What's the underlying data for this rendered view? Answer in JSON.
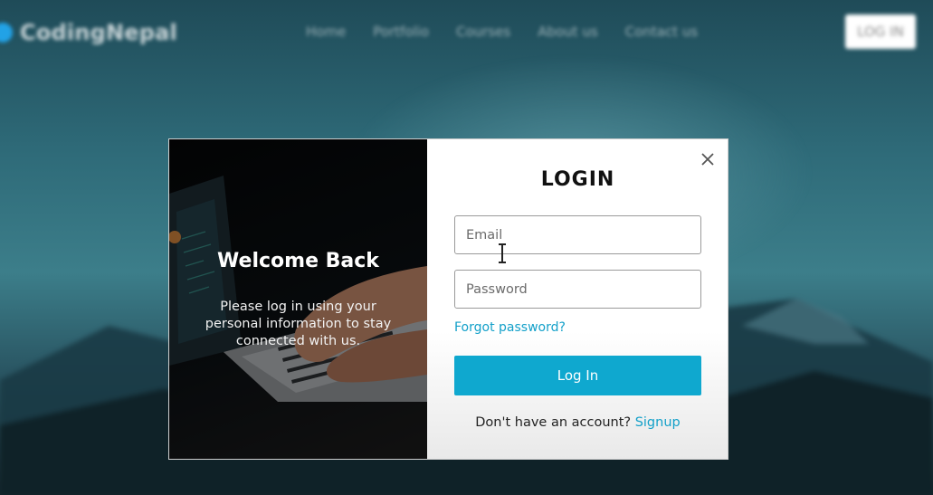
{
  "navbar": {
    "logo_text": "CodingNepal",
    "links": [
      "Home",
      "Portfolio",
      "Courses",
      "About us",
      "Contact us"
    ],
    "login_label": "LOG IN"
  },
  "modal": {
    "welcome_title": "Welcome Back",
    "welcome_text": "Please log in using your personal information to stay connected with us.",
    "login_title": "LOGIN",
    "email": {
      "value": "",
      "placeholder": "Email"
    },
    "password": {
      "value": "",
      "placeholder": "Password"
    },
    "forgot_label": "Forgot password?",
    "login_button_label": "Log In",
    "signup_prompt": "Don't have an account?",
    "signup_label": "Signup"
  },
  "colors": {
    "accent": "#0fa8cf",
    "link": "#13a0c9",
    "logo_dot": "#22a2e6"
  },
  "icons": {
    "close": "close-icon",
    "cursor": "text-cursor-icon"
  }
}
